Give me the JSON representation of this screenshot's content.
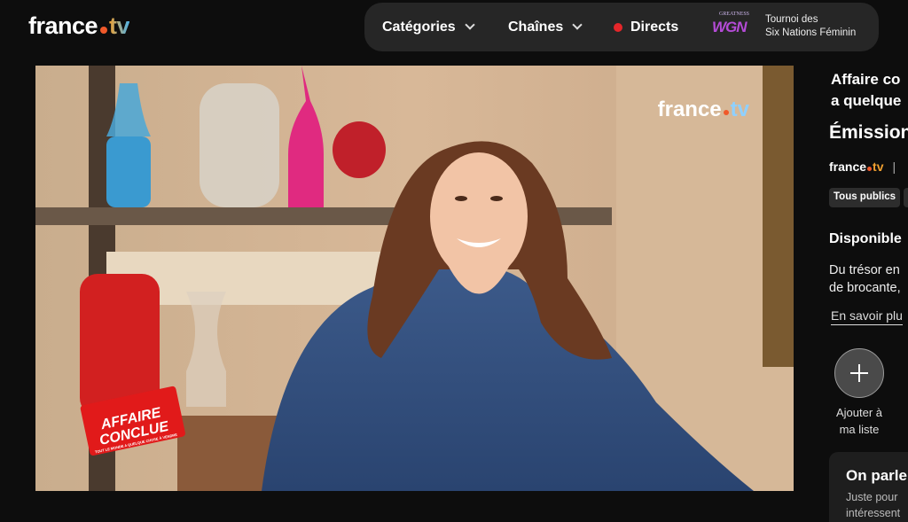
{
  "header": {
    "logo": {
      "word": "france",
      "suffix": "tv"
    },
    "nav": {
      "categories": "Catégories",
      "channels": "Chaînes",
      "live": "Directs"
    },
    "promo": {
      "logo_top": "GREATNESS",
      "logo_main": "WGN",
      "line1": "Tournoi des",
      "line2": "Six Nations Féminin"
    }
  },
  "player": {
    "watermark": {
      "word": "france",
      "suffix": "tv"
    },
    "show_logo": {
      "line1": "AFFAIRE",
      "line2": "CONCLUE",
      "tagline": "TOUT LE MONDE A QUELQUE CHOSE À VENDRE"
    }
  },
  "sidebar": {
    "title_line1": "Affaire co",
    "title_line2": "a quelque",
    "heading": "Émission",
    "channel": {
      "word": "france",
      "suffix": "tv",
      "separator": "|"
    },
    "badges": [
      "Tous publics",
      ""
    ],
    "availability": "Disponible",
    "desc_line1": "Du trésor en",
    "desc_line2": "de brocante,",
    "more_link": "En savoir plu",
    "add_label_line1": "Ajouter à",
    "add_label_line2": "ma liste",
    "card": {
      "title": "On parle",
      "line1": "Juste pour",
      "line2": "intéressent"
    }
  },
  "colors": {
    "background": "#0d0d0d",
    "pill": "#262626",
    "live": "#e5262a",
    "accent_orange": "#f0592a"
  }
}
